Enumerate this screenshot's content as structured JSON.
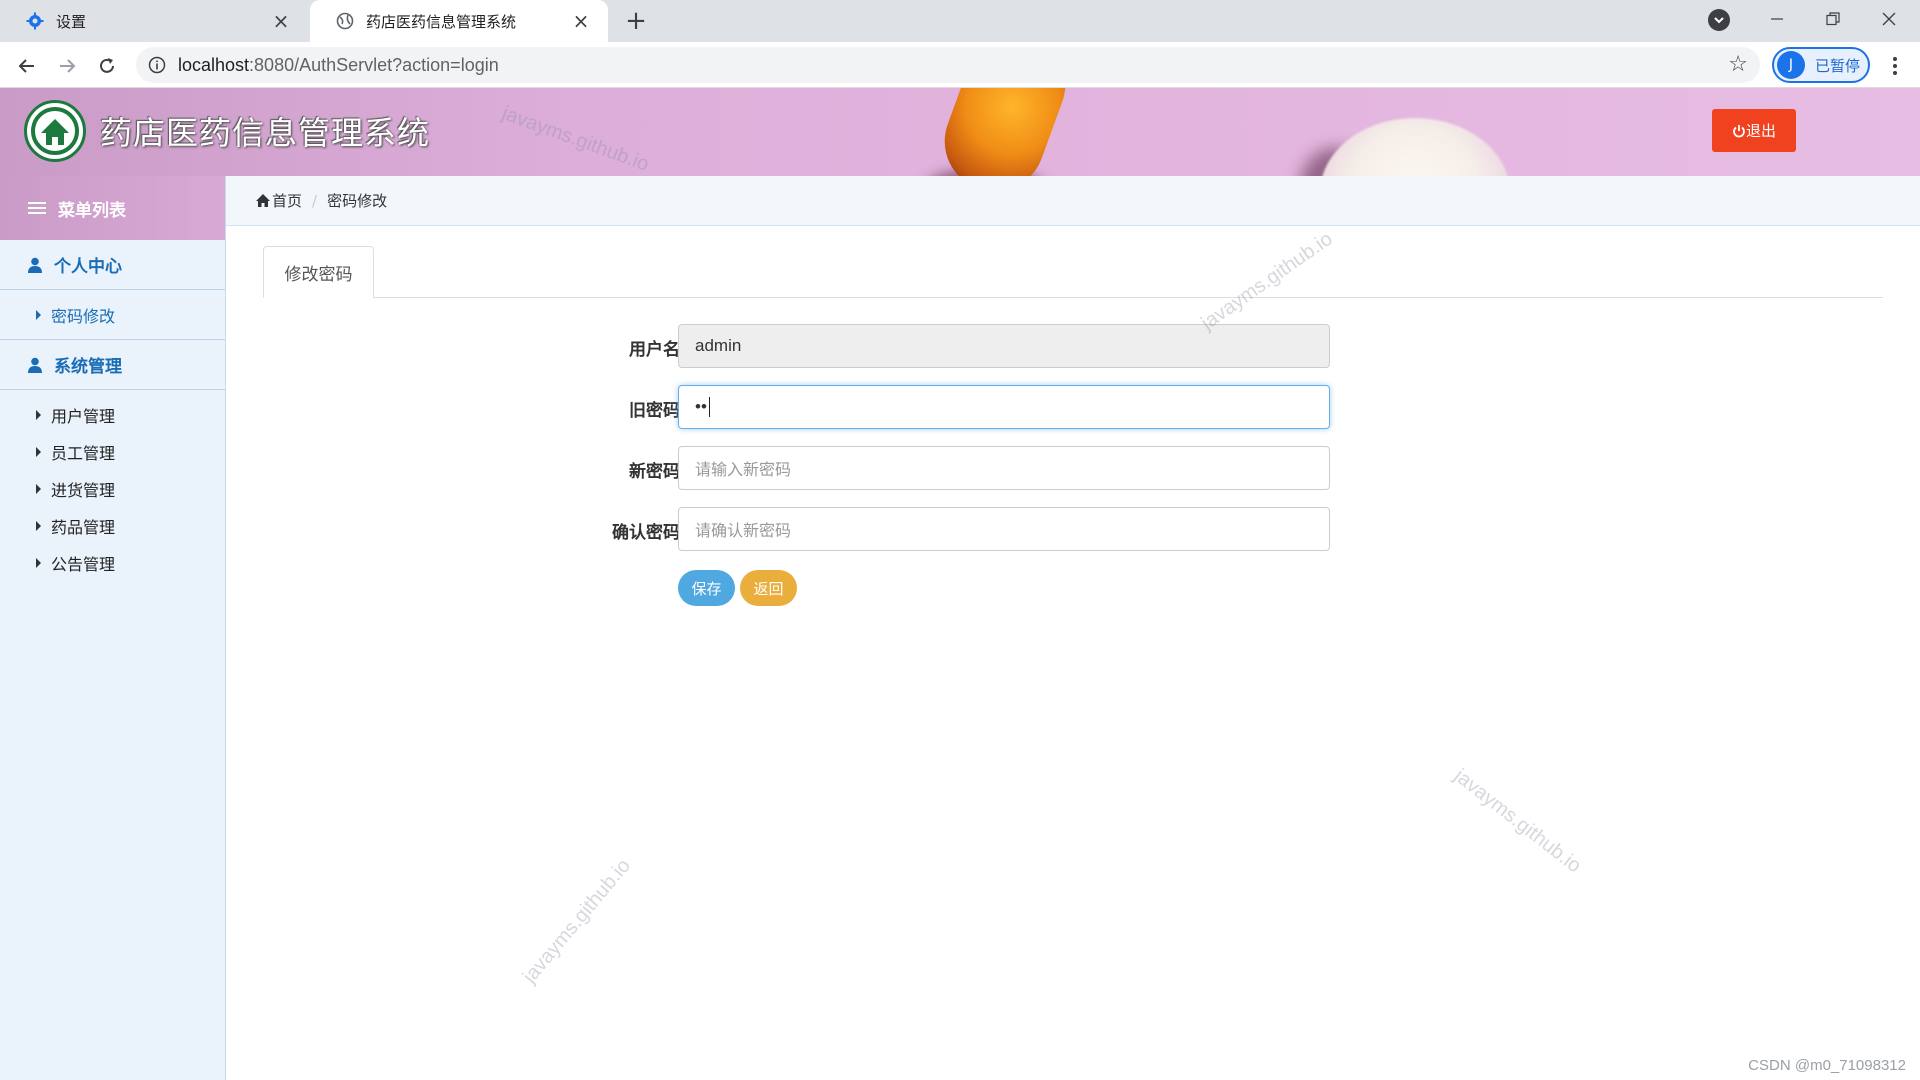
{
  "browser": {
    "tabs": [
      {
        "title": "设置",
        "icon": "gear-icon"
      },
      {
        "title": "药店医药信息管理系统",
        "icon": "globe-icon"
      }
    ],
    "url_host": "localhost",
    "url_rest": ":8080/AuthServlet?action=login",
    "profile_initial": "J",
    "profile_label": "已暂停"
  },
  "header": {
    "title": "药店医药信息管理系统",
    "logout_label": "退出",
    "watermark": "javayms.github.io"
  },
  "sidebar": {
    "title": "菜单列表",
    "groups": [
      {
        "label": "个人中心",
        "items": [
          "密码修改"
        ]
      },
      {
        "label": "系统管理",
        "items": [
          "用户管理",
          "员工管理",
          "进货管理",
          "药品管理",
          "公告管理"
        ]
      }
    ]
  },
  "breadcrumb": {
    "home": "首页",
    "current": "密码修改"
  },
  "main": {
    "tab": "修改密码",
    "fields": {
      "username": {
        "label": "用户名",
        "value": "admin"
      },
      "old_password": {
        "label": "旧密码",
        "value": "••"
      },
      "new_password": {
        "label": "新密码",
        "placeholder": "请输入新密码"
      },
      "confirm_password": {
        "label": "确认密码",
        "placeholder": "请确认新密码"
      }
    },
    "save_label": "保存",
    "back_label": "返回"
  },
  "footer_watermark": "CSDN @m0_71098312"
}
